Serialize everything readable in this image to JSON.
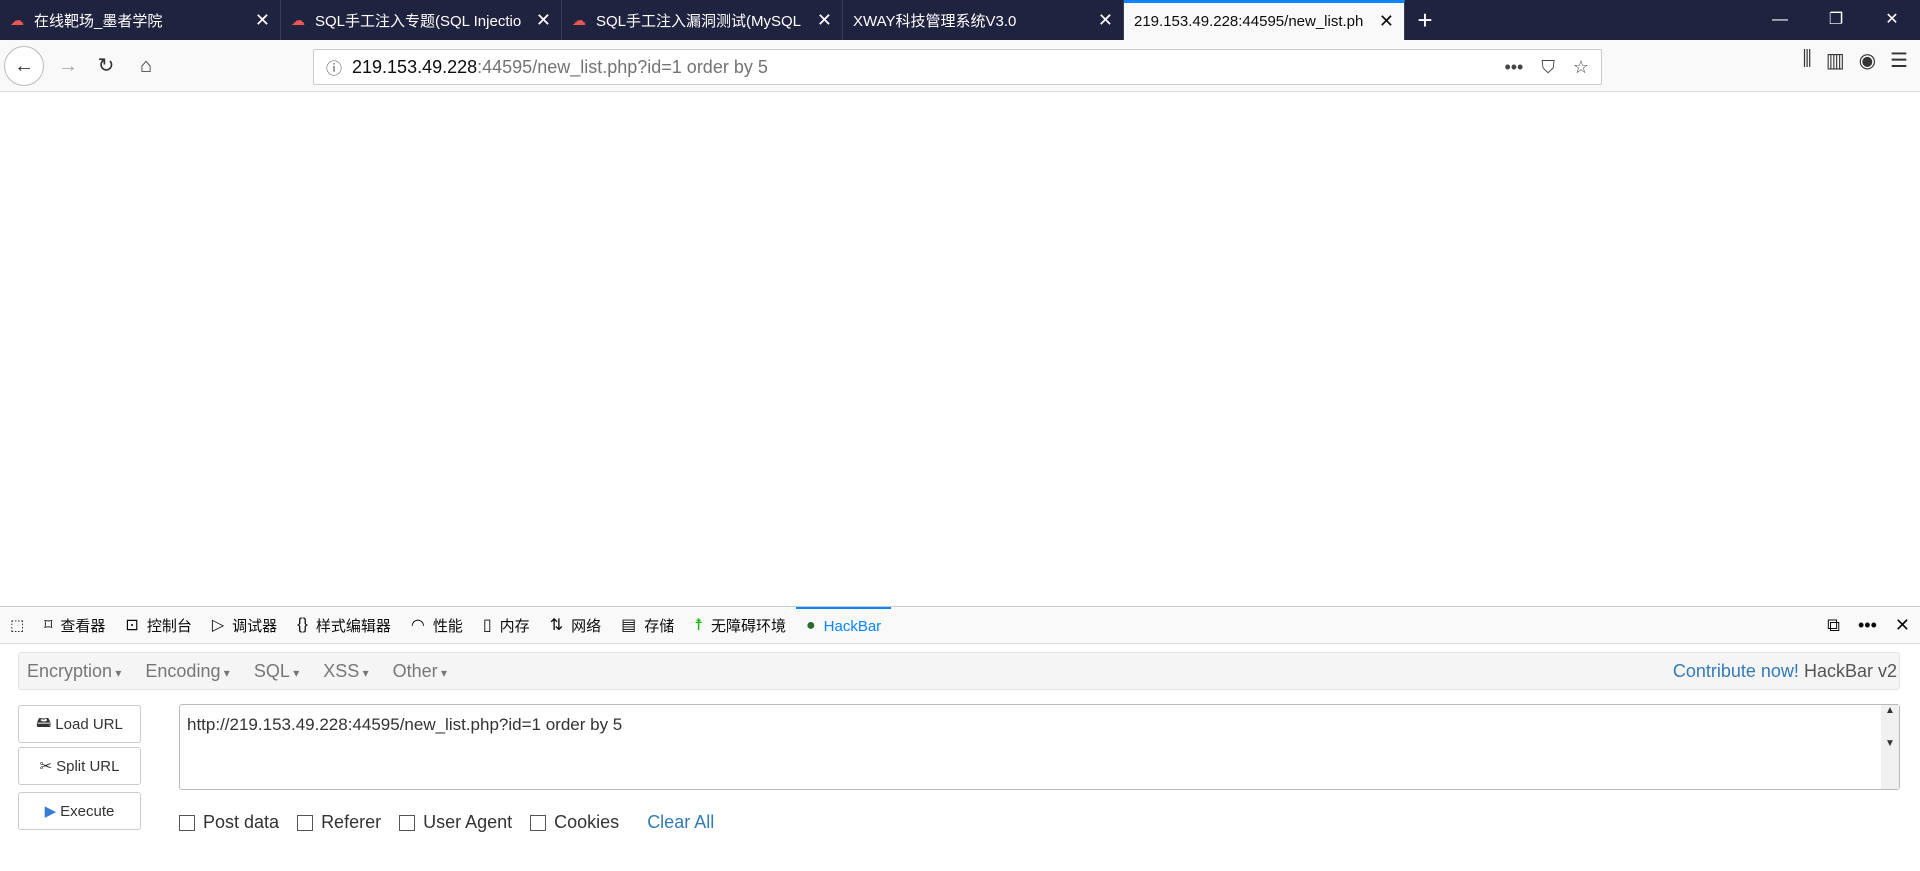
{
  "tabs": [
    {
      "title": "在线靶场_墨者学院",
      "icon": "cloud-icon"
    },
    {
      "title": "SQL手工注入专题(SQL Injectio",
      "icon": "cloud-icon"
    },
    {
      "title": "SQL手工注入漏洞测试(MySQL",
      "icon": "cloud-icon"
    },
    {
      "title": "XWAY科技管理系统V3.0",
      "icon": ""
    },
    {
      "title": "219.153.49.228:44595/new_list.ph",
      "active": true
    }
  ],
  "urlbar": {
    "host": "219.153.49.228",
    "rest": ":44595/new_list.php?id=1 order by 5"
  },
  "devtools": {
    "tabs": [
      "查看器",
      "控制台",
      "调试器",
      "样式编辑器",
      "性能",
      "内存",
      "网络",
      "存储",
      "无障碍环境",
      "HackBar"
    ]
  },
  "hackbar": {
    "menus": [
      "Encryption",
      "Encoding",
      "SQL",
      "XSS",
      "Other"
    ],
    "contribute": "Contribute now!",
    "version": "HackBar v2",
    "buttons": [
      "Load URL",
      "Split URL",
      "Execute"
    ],
    "url_value": "http://219.153.49.228:44595/new_list.php?id=1 order by 5",
    "checks": [
      "Post data",
      "Referer",
      "User Agent",
      "Cookies"
    ],
    "clear": "Clear All"
  },
  "colors": {
    "accent": "#0a84ff",
    "tabbar": "#202340",
    "link": "#337ab7"
  }
}
